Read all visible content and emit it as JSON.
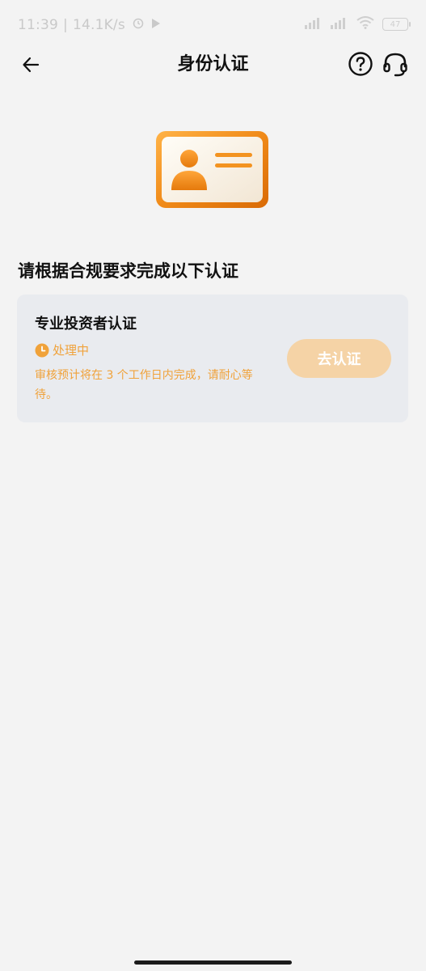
{
  "status_bar": {
    "time": "11:39",
    "speed": "14.1K/s",
    "battery": "47",
    "icons": [
      "alarm-icon",
      "play-icon",
      "signal-icon",
      "signal-icon",
      "wifi-icon",
      "battery-icon"
    ]
  },
  "nav": {
    "title": "身份认证",
    "back_icon": "arrow-left-icon",
    "help_icon": "question-circle-icon",
    "service_icon": "headset-icon"
  },
  "section_heading": "请根据合规要求完成以下认证",
  "certification": {
    "title": "专业投资者认证",
    "status": "处理中",
    "description": "审核预计将在 3 个工作日内完成，请耐心等待。",
    "button_label": "去认证"
  },
  "colors": {
    "background": "#f3f3f3",
    "card": "#e9ebef",
    "accent_orange": "#f0a23a",
    "button_disabled": "#f5d3a6"
  }
}
